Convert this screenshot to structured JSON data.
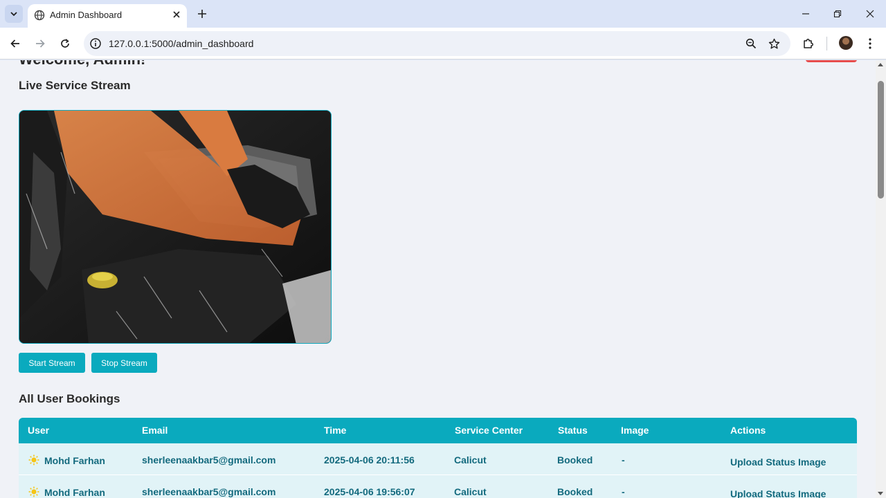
{
  "browser": {
    "tab_title": "Admin Dashboard",
    "url": "127.0.0.1:5000/admin_dashboard"
  },
  "page": {
    "welcome_text": "Welcome, Admin!",
    "stream_section_title": "Live Service Stream",
    "start_stream_label": "Start Stream",
    "stop_stream_label": "Stop Stream",
    "bookings_section_title": "All User Bookings"
  },
  "table": {
    "headers": {
      "user": "User",
      "email": "Email",
      "time": "Time",
      "service_center": "Service Center",
      "status": "Status",
      "image": "Image",
      "actions": "Actions"
    },
    "rows": [
      {
        "user": "Mohd Farhan",
        "email": "sherleenaakbar5@gmail.com",
        "time": "2025-04-06 20:11:56",
        "service_center": "Calicut",
        "status": "Booked",
        "image": "-",
        "action": "Upload Status Image"
      },
      {
        "user": "Mohd Farhan",
        "email": "sherleenaakbar5@gmail.com",
        "time": "2025-04-06 19:56:07",
        "service_center": "Calicut",
        "status": "Booked",
        "image": "-",
        "action": "Upload Status Image"
      }
    ]
  },
  "colors": {
    "accent": "#0aaabe",
    "row_background": "#e1f3f7",
    "row_text": "#136a7e",
    "logout": "#e74c4c"
  },
  "icons": {
    "user_row_icon": "sun-icon"
  }
}
